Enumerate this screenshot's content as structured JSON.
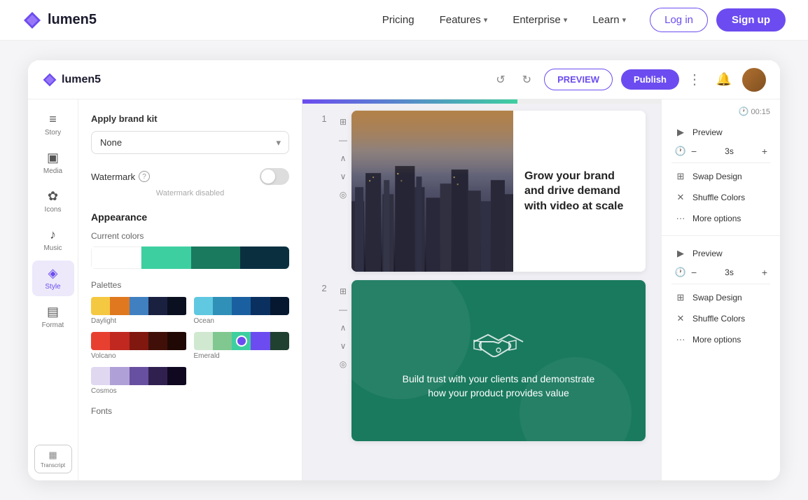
{
  "navbar": {
    "logo_text": "lumen5",
    "links": [
      {
        "label": "Pricing",
        "has_dropdown": false
      },
      {
        "label": "Features",
        "has_dropdown": true
      },
      {
        "label": "Enterprise",
        "has_dropdown": true
      },
      {
        "label": "Learn",
        "has_dropdown": true
      }
    ],
    "login_label": "Log in",
    "signup_label": "Sign up"
  },
  "app": {
    "logo_text": "lumen5",
    "header": {
      "preview_label": "PREVIEW",
      "publish_label": "Publish",
      "undo_label": "↺",
      "redo_label": "↻"
    },
    "sidebar": {
      "items": [
        {
          "label": "Story",
          "icon": "≡"
        },
        {
          "label": "Media",
          "icon": "▣"
        },
        {
          "label": "Icons",
          "icon": "✿"
        },
        {
          "label": "Music",
          "icon": "♪"
        },
        {
          "label": "Style",
          "icon": "◈"
        },
        {
          "label": "Format",
          "icon": "▤"
        }
      ],
      "transcript_label": "Transcript"
    },
    "style_panel": {
      "brand_kit_title": "Apply brand kit",
      "brand_kit_option": "None",
      "watermark_label": "Watermark",
      "watermark_disabled_text": "Watermark disabled",
      "appearance_title": "Appearance",
      "current_colors_label": "Current colors",
      "palettes_label": "Palettes",
      "fonts_label": "Fonts",
      "colors": [
        "#ffffff",
        "#3ecfa0",
        "#1a7a5e",
        "#0a3040"
      ],
      "palettes": [
        {
          "name": "Daylight",
          "colors": [
            "#f5c842",
            "#e07820",
            "#4080c0",
            "#1a2040",
            "#0a1020"
          ]
        },
        {
          "name": "Ocean",
          "colors": [
            "#60c8e0",
            "#3090b8",
            "#1a60a0",
            "#0a3060",
            "#051830"
          ]
        },
        {
          "name": "Volcano",
          "colors": [
            "#e84030",
            "#c02820",
            "#801810",
            "#401008",
            "#200804"
          ]
        },
        {
          "name": "Emerald",
          "colors": [
            "#d0e8d0",
            "#80c890",
            "#3ecfa0",
            "#6c4cf0",
            "#204030"
          ]
        },
        {
          "name": "Cosmos",
          "colors": [
            "#e0d8f0",
            "#b0a0d8",
            "#6850a0",
            "#302050",
            "#100820"
          ]
        }
      ]
    },
    "slides": [
      {
        "number": "1",
        "headline": "Grow your brand and drive demand with video at scale",
        "time": "00:15",
        "duration": "3s",
        "actions": [
          "Preview",
          "Swap Design",
          "Shuffle Colors",
          "More options"
        ]
      },
      {
        "number": "2",
        "text": "Build trust with your clients and demonstrate how your product provides value",
        "duration": "3s",
        "actions": [
          "Preview",
          "Swap Design",
          "Shuffle Colors",
          "More options"
        ]
      }
    ]
  }
}
